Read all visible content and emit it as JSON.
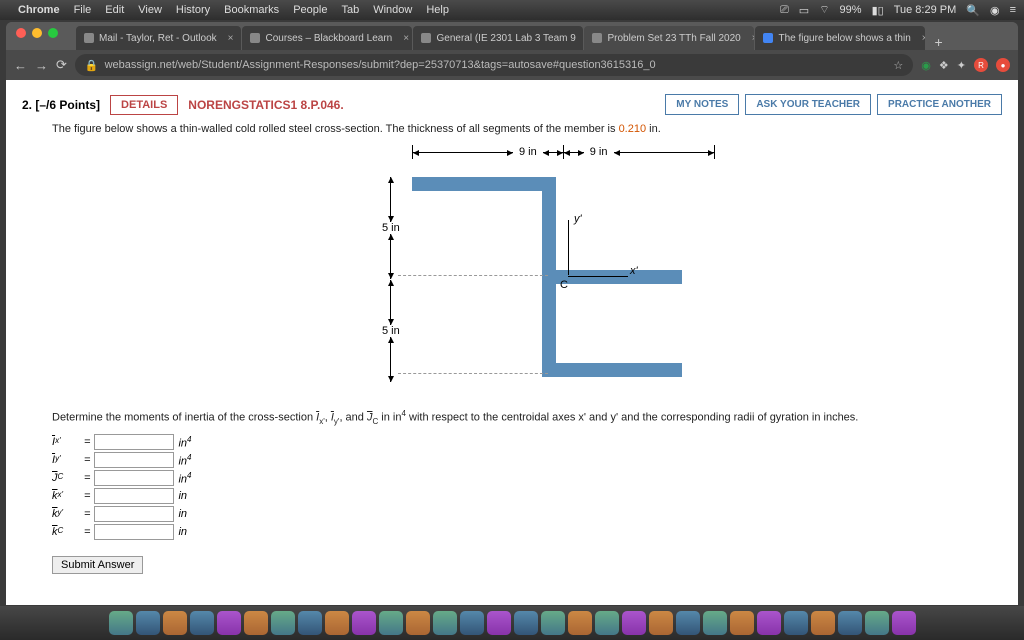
{
  "menubar": {
    "app": "Chrome",
    "items": [
      "File",
      "Edit",
      "View",
      "History",
      "Bookmarks",
      "People",
      "Tab",
      "Window",
      "Help"
    ],
    "battery": "99%",
    "clock": "Tue 8:29 PM"
  },
  "tabs": [
    {
      "label": "Mail - Taylor, Ret - Outlook"
    },
    {
      "label": "Courses – Blackboard Learn"
    },
    {
      "label": "General (IE 2301 Lab 3 Team 9"
    },
    {
      "label": "Problem Set 23 TTh Fall 2020",
      "active": true
    },
    {
      "label": "The figure below shows a thin"
    }
  ],
  "url": "webassign.net/web/Student/Assignment-Responses/submit?dep=25370713&tags=autosave#question3615316_0",
  "question": {
    "number": "2.",
    "points": "[–/6 Points]",
    "details": "DETAILS",
    "source": "NORENGSTATICS1 8.P.046.",
    "mynotes": "MY NOTES",
    "ask": "ASK YOUR TEACHER",
    "practice": "PRACTICE ANOTHER",
    "prompt_pre": "The figure below shows a thin-walled cold rolled steel cross-section. The thickness of all segments of the member is ",
    "thickness": "0.210",
    "prompt_post": " in.",
    "dim_top1": "9 in",
    "dim_top2": "9 in",
    "dim_left1": "5 in",
    "dim_left2": "5 in",
    "axis_y": "y'",
    "axis_x": "x'",
    "centroid": "C",
    "prompt2_a": "Determine the moments of inertia of the cross-section ",
    "prompt2_b": " with respect to the centroidal axes x' and y' and the corresponding radii of gyration in inches.",
    "rows": [
      {
        "sym": "I",
        "sub": "x'",
        "unit_base": "in",
        "unit_sup": "4"
      },
      {
        "sym": "I",
        "sub": "y'",
        "unit_base": "in",
        "unit_sup": "4"
      },
      {
        "sym": "J",
        "sub": "C",
        "unit_base": "in",
        "unit_sup": "4"
      },
      {
        "sym": "k",
        "sub": "x'",
        "unit_base": "in",
        "unit_sup": ""
      },
      {
        "sym": "k",
        "sub": "y'",
        "unit_base": "in",
        "unit_sup": ""
      },
      {
        "sym": "k",
        "sub": "C",
        "unit_base": "in",
        "unit_sup": ""
      }
    ],
    "submit": "Submit Answer"
  }
}
